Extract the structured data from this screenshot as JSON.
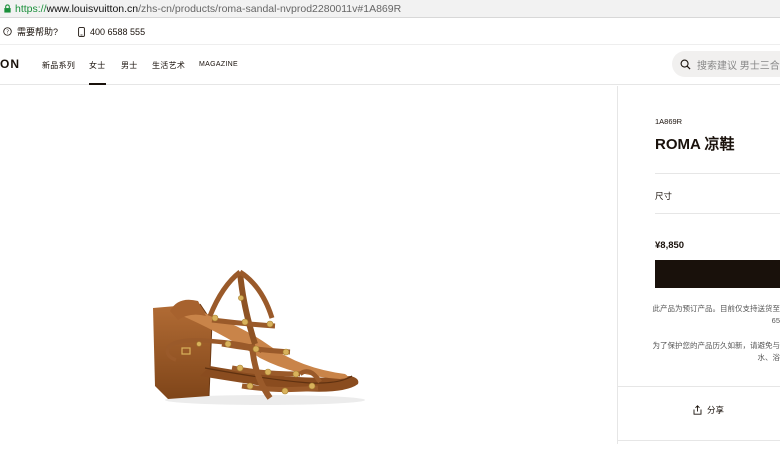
{
  "browser": {
    "url_scheme": "https://",
    "url_host": "www.louisvuitton.cn",
    "url_path": "/zhs-cn/products/roma-sandal-nvprod2280011v#1A869R"
  },
  "utility": {
    "help_label": "需要帮助?",
    "phone": "400 6588 555"
  },
  "nav": {
    "logo_text": "ON",
    "links": [
      {
        "label": "新品系列"
      },
      {
        "label": "女士",
        "active": true
      },
      {
        "label": "男士"
      },
      {
        "label": "生活艺术"
      },
      {
        "label": "MAGAZINE"
      }
    ],
    "search_placeholder": "搜索建议 男士三合一"
  },
  "product": {
    "sku": "1A869R",
    "title": "ROMA 凉鞋",
    "size_label": "尺寸",
    "price": "¥8,850",
    "preorder_note_line1": "此产品为预订产品。目前仅支持送货至",
    "preorder_note_line2": "65",
    "protect_note_line1": "为了保护您的产品历久如新，请避免与",
    "protect_note_line2": "水、浴",
    "share_label": "分享"
  },
  "colors": {
    "brand_dark": "#19110b",
    "sandal_leather": "#9a5a2a",
    "stud_gold": "#d9b25c"
  }
}
